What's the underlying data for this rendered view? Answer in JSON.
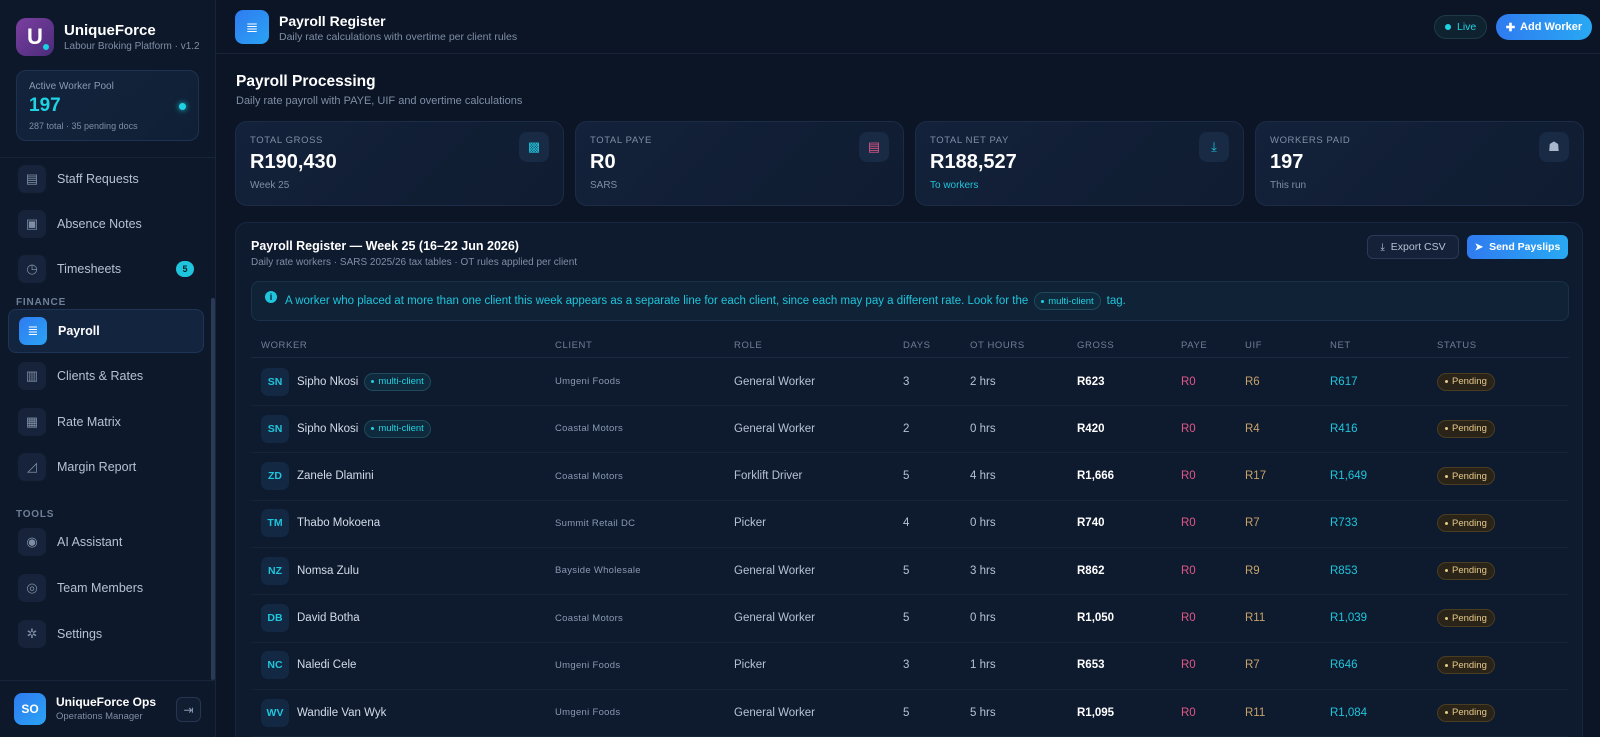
{
  "brand": {
    "name": "UniqueForce",
    "logo_letter": "U",
    "subtitle": "Labour Broking Platform · v1.2"
  },
  "pool": {
    "label": "Active Worker Pool",
    "value": "197",
    "sub": "287 total · 35 pending docs"
  },
  "nav": {
    "items": [
      {
        "label": "Staff Requests",
        "icon": "clipboard-icon",
        "glyph": "▤"
      },
      {
        "label": "Absence Notes",
        "icon": "note-icon",
        "glyph": "▣"
      },
      {
        "label": "Timesheets",
        "icon": "clock-icon",
        "glyph": "◷",
        "badge": "5"
      }
    ],
    "finance_section": "FINANCE",
    "finance_items": [
      {
        "label": "Payroll",
        "icon": "money-stack-icon",
        "glyph": "≣",
        "active": true
      },
      {
        "label": "Clients & Rates",
        "icon": "building-icon",
        "glyph": "▥"
      },
      {
        "label": "Rate Matrix",
        "icon": "grid-icon",
        "glyph": "▦"
      },
      {
        "label": "Margin Report",
        "icon": "chart-icon",
        "glyph": "◿"
      }
    ],
    "tools_section": "TOOLS",
    "tools_items": [
      {
        "label": "AI Assistant",
        "icon": "robot-icon",
        "glyph": "◉"
      },
      {
        "label": "Team Members",
        "icon": "users-cog-icon",
        "glyph": "◎"
      },
      {
        "label": "Settings",
        "icon": "gear-icon",
        "glyph": "✲"
      }
    ]
  },
  "user": {
    "initials": "SO",
    "name": "UniqueForce Ops",
    "role": "Operations Manager"
  },
  "header": {
    "title": "Payroll Register",
    "subtitle": "Daily rate calculations with overtime per client rules",
    "live": "Live",
    "add_worker": "Add Worker"
  },
  "main": {
    "title": "Payroll Processing",
    "subtitle": "Daily rate payroll with PAYE, UIF and overtime calculations"
  },
  "stats": [
    {
      "label": "TOTAL GROSS",
      "value": "R190,430",
      "sub": "Week 25",
      "icon": "cash-icon",
      "color": "#1fc5dc",
      "glyph": "▩"
    },
    {
      "label": "TOTAL PAYE",
      "value": "R0",
      "sub": "SARS",
      "icon": "receipt-icon",
      "color": "#e0588a",
      "glyph": "▤"
    },
    {
      "label": "TOTAL NET PAY",
      "value": "R188,527",
      "sub": "To workers",
      "icon": "hand-coin-icon",
      "color": "#1fc5dc",
      "glyph": "⤓"
    },
    {
      "label": "WORKERS PAID",
      "value": "197",
      "sub": "This run",
      "icon": "users-icon",
      "color": "#a9b7cc",
      "glyph": "☗"
    }
  ],
  "register": {
    "title": "Payroll Register — Week 25 (16–22 Jun 2026)",
    "subtitle": "Daily rate workers · SARS 2025/26 tax tables · OT rules applied per client",
    "export_label": "Export CSV",
    "send_label": "Send Payslips",
    "info_text": "A worker who placed at more than one client this week appears as a separate line for each client, since each may pay a different rate. Look for the",
    "info_tag": "multi-client",
    "info_end": "tag.",
    "columns": [
      "WORKER",
      "CLIENT",
      "ROLE",
      "DAYS",
      "OT HOURS",
      "GROSS",
      "PAYE",
      "UIF",
      "NET",
      "STATUS"
    ],
    "rows": [
      {
        "initials": "SN",
        "name": "Sipho Nkosi",
        "tag": "multi-client",
        "client": "Umgeni Foods",
        "role": "General Worker",
        "days": "3",
        "ot": "2 hrs",
        "gross": "R623",
        "paye": "R0",
        "uif": "R6",
        "net": "R617",
        "status": "Pending"
      },
      {
        "initials": "SN",
        "name": "Sipho Nkosi",
        "tag": "multi-client",
        "client": "Coastal Motors",
        "role": "General Worker",
        "days": "2",
        "ot": "0 hrs",
        "gross": "R420",
        "paye": "R0",
        "uif": "R4",
        "net": "R416",
        "status": "Pending"
      },
      {
        "initials": "ZD",
        "name": "Zanele Dlamini",
        "tag": "",
        "client": "Coastal Motors",
        "role": "Forklift Driver",
        "days": "5",
        "ot": "4 hrs",
        "gross": "R1,666",
        "paye": "R0",
        "uif": "R17",
        "net": "R1,649",
        "status": "Pending"
      },
      {
        "initials": "TM",
        "name": "Thabo Mokoena",
        "tag": "",
        "client": "Summit Retail DC",
        "role": "Picker",
        "days": "4",
        "ot": "0 hrs",
        "gross": "R740",
        "paye": "R0",
        "uif": "R7",
        "net": "R733",
        "status": "Pending"
      },
      {
        "initials": "NZ",
        "name": "Nomsa Zulu",
        "tag": "",
        "client": "Bayside Wholesale",
        "role": "General Worker",
        "days": "5",
        "ot": "3 hrs",
        "gross": "R862",
        "paye": "R0",
        "uif": "R9",
        "net": "R853",
        "status": "Pending"
      },
      {
        "initials": "DB",
        "name": "David Botha",
        "tag": "",
        "client": "Coastal Motors",
        "role": "General Worker",
        "days": "5",
        "ot": "0 hrs",
        "gross": "R1,050",
        "paye": "R0",
        "uif": "R11",
        "net": "R1,039",
        "status": "Pending"
      },
      {
        "initials": "NC",
        "name": "Naledi Cele",
        "tag": "",
        "client": "Umgeni Foods",
        "role": "Picker",
        "days": "3",
        "ot": "1 hrs",
        "gross": "R653",
        "paye": "R0",
        "uif": "R7",
        "net": "R646",
        "status": "Pending"
      },
      {
        "initials": "WV",
        "name": "Wandile Van Wyk",
        "tag": "",
        "client": "Umgeni Foods",
        "role": "General Worker",
        "days": "5",
        "ot": "5 hrs",
        "gross": "R1,095",
        "paye": "R0",
        "uif": "R11",
        "net": "R1,084",
        "status": "Pending"
      }
    ]
  }
}
